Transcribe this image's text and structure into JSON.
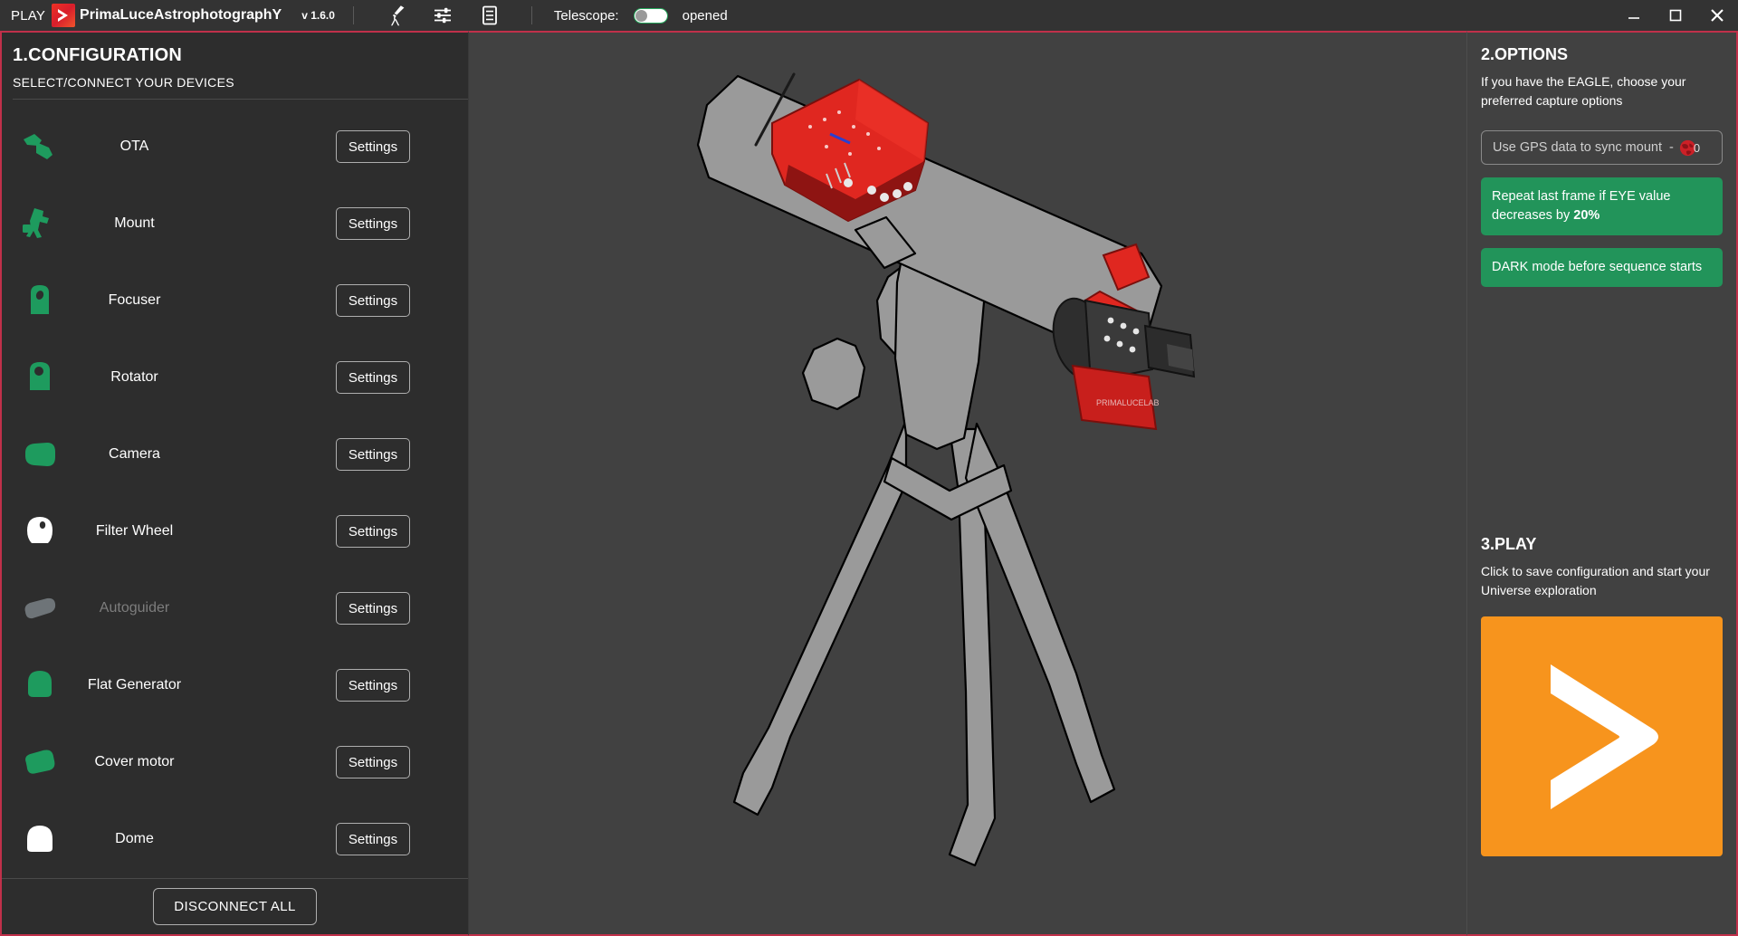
{
  "titlebar": {
    "play_word": "PLAY",
    "logo_icon": "primaluce-chevron-logo",
    "app_name_prefix": "P",
    "app_name": "PrimaLuceAstrophotographY",
    "version": "v 1.6.0",
    "icons": [
      {
        "name": "telescope-icon",
        "label": "telescope"
      },
      {
        "name": "sliders-icon",
        "label": "settings-sliders"
      },
      {
        "name": "log-book-icon",
        "label": "log"
      }
    ],
    "telescope_label": "Telescope:",
    "telescope_state": "opened",
    "toggle_on": false,
    "window_controls": [
      {
        "name": "minimize-button",
        "glyph": "minimize"
      },
      {
        "name": "maximize-button",
        "glyph": "maximize"
      },
      {
        "name": "close-button",
        "glyph": "close"
      }
    ]
  },
  "left_panel": {
    "title": "1.CONFIGURATION",
    "subtitle": "SELECT/CONNECT YOUR DEVICES",
    "settings_label": "Settings",
    "disconnect_label": "DISCONNECT ALL",
    "devices": [
      {
        "label": "OTA",
        "icon": "ota-tube-icon",
        "status": "connected",
        "color": "#1e9b5e"
      },
      {
        "label": "Mount",
        "icon": "mount-icon",
        "status": "connected",
        "color": "#1e9b5e"
      },
      {
        "label": "Focuser",
        "icon": "focuser-icon",
        "status": "connected",
        "color": "#1e9b5e"
      },
      {
        "label": "Rotator",
        "icon": "rotator-icon",
        "status": "connected",
        "color": "#1e9b5e"
      },
      {
        "label": "Camera",
        "icon": "camera-icon",
        "status": "connected",
        "color": "#1e9b5e"
      },
      {
        "label": "Filter Wheel",
        "icon": "filter-wheel-icon",
        "status": "idle",
        "color": "#ffffff"
      },
      {
        "label": "Autoguider",
        "icon": "autoguider-icon",
        "status": "disabled",
        "color": "#6e7478"
      },
      {
        "label": "Flat Generator",
        "icon": "flat-generator-icon",
        "status": "connected",
        "color": "#1e9b5e"
      },
      {
        "label": "Cover motor",
        "icon": "cover-motor-icon",
        "status": "connected",
        "color": "#1e9b5e"
      },
      {
        "label": "Dome",
        "icon": "dome-icon",
        "status": "idle",
        "color": "#ffffff"
      }
    ]
  },
  "center_panel": {
    "illustration": "telescope-ota-with-eagle-and-camera"
  },
  "right_panel": {
    "options_title": "2.OPTIONS",
    "options_desc": "If you have the EAGLE, choose your preferred capture options",
    "gps_label": "Use GPS data to sync mount",
    "gps_dash": "-",
    "gps_icon": "globe-icon",
    "gps_count": "0",
    "option_buttons": [
      {
        "name": "repeat-last-frame-option",
        "text_a": "Repeat last frame if EYE value decreases by ",
        "text_b": "20%"
      },
      {
        "name": "dark-mode-option",
        "text_a": "DARK mode before sequence starts",
        "text_b": ""
      }
    ],
    "play_title": "3.PLAY",
    "play_desc": "Click to save configuration and start your Universe exploration",
    "play_icon": "chevron-right-icon",
    "play_color": "#F7941D"
  },
  "colors": {
    "accent_red": "#c0304a",
    "panel_dark": "#2d2d2d",
    "panel_mid": "#414141",
    "green": "#22945a",
    "orange": "#F7941D"
  }
}
